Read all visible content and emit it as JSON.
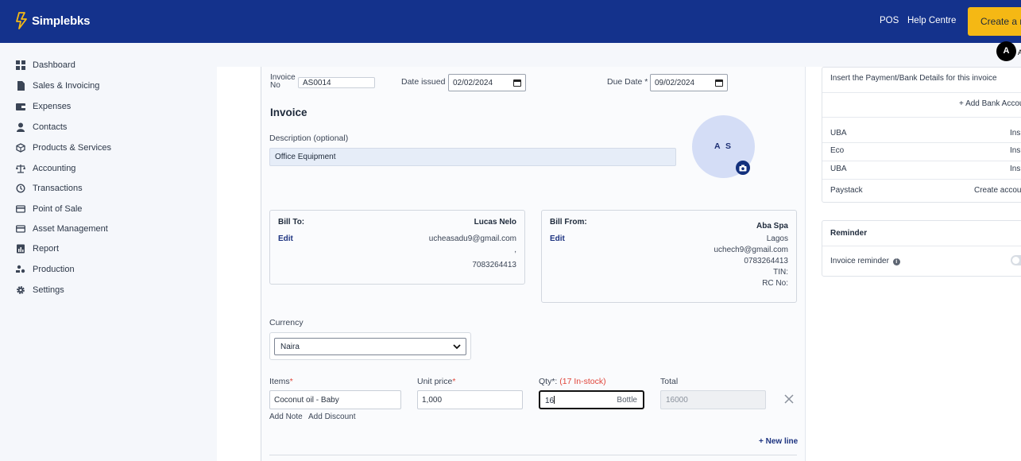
{
  "header": {
    "brand": "Simplebks",
    "pos_label": "POS",
    "help_label": "Help Centre",
    "create_label": "Create a n",
    "user_initial": "A",
    "user_initial_tail": "A"
  },
  "sidebar": {
    "items": [
      {
        "label": "Dashboard",
        "icon": "dashboard-icon"
      },
      {
        "label": "Sales & Invoicing",
        "icon": "document-icon"
      },
      {
        "label": "Expenses",
        "icon": "wallet-icon"
      },
      {
        "label": "Contacts",
        "icon": "person-icon"
      },
      {
        "label": "Products & Services",
        "icon": "box-icon"
      },
      {
        "label": "Accounting",
        "icon": "scale-icon"
      },
      {
        "label": "Transactions",
        "icon": "history-icon"
      },
      {
        "label": "Point of Sale",
        "icon": "card-icon"
      },
      {
        "label": "Asset Management",
        "icon": "card-icon"
      },
      {
        "label": "Report",
        "icon": "report-icon"
      },
      {
        "label": "Production",
        "icon": "production-icon"
      },
      {
        "label": "Settings",
        "icon": "gear-icon"
      }
    ]
  },
  "invoice": {
    "invoice_no_label": "Invoice No",
    "invoice_no_value": "AS0014",
    "date_issued_label": "Date issued",
    "date_issued_value": "02/02/2024",
    "due_date_label": "Due Date *",
    "due_date_value": "09/02/2024",
    "title": "Invoice",
    "description_label": "Description (optional)",
    "description_value": "Office Equipment",
    "logo_initials": "A S"
  },
  "bill_to": {
    "label": "Bill To:",
    "edit": "Edit",
    "name": "Lucas Nelo",
    "email": "ucheasadu9@gmail.com",
    "separator": ",",
    "phone": "7083264413"
  },
  "bill_from": {
    "label": "Bill From:",
    "edit": "Edit",
    "name": "Aba Spa",
    "city": "Lagos",
    "email": "uchech9@gmail.com",
    "phone": "0783264413",
    "tin": "TIN:",
    "rc": "RC No:"
  },
  "currency": {
    "label": "Currency",
    "selected": "Naira"
  },
  "line_item": {
    "items_label": "Items",
    "item_value": "Coconut oil - Baby",
    "unit_price_label": "Unit price",
    "unit_price_value": "1,000",
    "qty_label": "Qty*: ",
    "qty_stock": "(17 In-stock)",
    "qty_value": "16",
    "qty_unit": "Bottle",
    "total_label": "Total",
    "total_value": "16000",
    "add_note": "Add Note",
    "add_discount": "Add Discount",
    "new_line": "+ New line"
  },
  "payment_panel": {
    "instruction": "Insert the Payment/Bank Details for this invoice",
    "add_bank": "+ Add Bank Accou",
    "banks": [
      {
        "name": "UBA",
        "action": "Ins"
      },
      {
        "name": "Eco",
        "action": "Ins"
      },
      {
        "name": "UBA",
        "action": "Ins"
      }
    ],
    "paystack_label": "Paystack",
    "paystack_action": "Create accou"
  },
  "reminder_panel": {
    "title": "Reminder",
    "invoice_reminder_label": "Invoice reminder",
    "info_glyph": "i"
  },
  "colors": {
    "header_bg": "#14328c",
    "accent": "#f5b814",
    "link": "#1d3380",
    "required": "#e0453a"
  }
}
